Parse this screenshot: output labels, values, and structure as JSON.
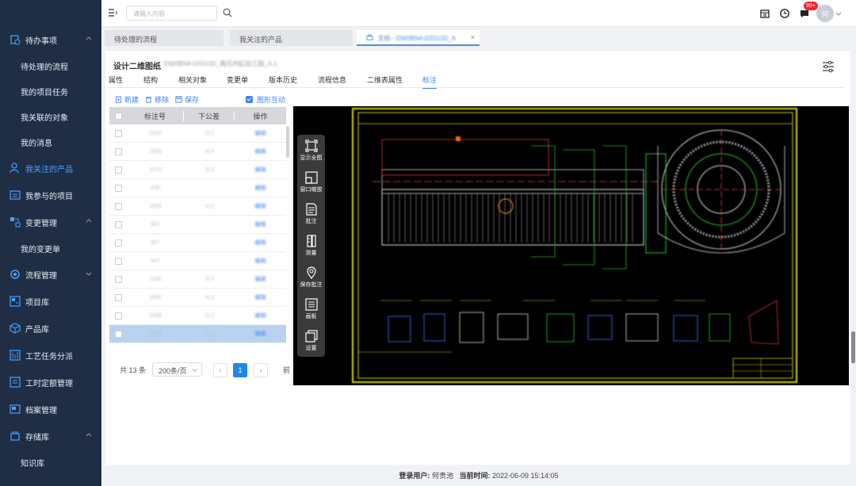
{
  "sidebar": {
    "groups": [
      {
        "label": "待办事项",
        "icon": "todo-icon",
        "expanded": true,
        "children": [
          "待处理的流程",
          "我的项目任务",
          "我关联的对象",
          "我的消息"
        ]
      },
      {
        "label": "我关注的产品",
        "icon": "user-follow-icon",
        "active": true
      },
      {
        "label": "我参与的项目",
        "icon": "project-icon"
      },
      {
        "label": "变更管理",
        "icon": "change-icon",
        "expanded": true,
        "children": [
          "我的变更单"
        ]
      },
      {
        "label": "流程管理",
        "icon": "workflow-icon",
        "expanded": false
      },
      {
        "label": "项目库",
        "icon": "library-icon"
      },
      {
        "label": "产品库",
        "icon": "cube-icon"
      },
      {
        "label": "工艺任务分派",
        "icon": "task-assign-icon"
      },
      {
        "label": "工时定额管理",
        "icon": "hours-icon"
      },
      {
        "label": "档案管理",
        "icon": "archive-icon"
      },
      {
        "label": "存储库",
        "icon": "storage-icon",
        "expanded": true,
        "children": [
          "知识库"
        ]
      }
    ]
  },
  "topbar": {
    "search_placeholder": "请输入内容",
    "notification_badge": "99+",
    "avatar_text": "何"
  },
  "tabs": [
    {
      "label": "待处理的流程",
      "active": false
    },
    {
      "label": "我关注的产品",
      "active": false
    },
    {
      "label": "文档 - DW0BN4-0201OD_A",
      "active": true,
      "close": "×"
    }
  ],
  "page": {
    "title": "设计二维图纸",
    "title_sub": "DW0BN4-0201OD_离压内缸加工图_A.1",
    "nav_tabs": [
      "属性",
      "结构",
      "相关对象",
      "变更单",
      "版本历史",
      "流程信息",
      "二维表属性",
      "标注"
    ],
    "active_nav": "标注"
  },
  "toolbar": {
    "new_label": "新建",
    "remove_label": "移除",
    "save_label": "保存",
    "interact_label": "图形互动"
  },
  "table": {
    "headers": [
      "标注号",
      "下公差",
      "操作"
    ],
    "rows": [
      {
        "no": "1610",
        "tol": "-0.2",
        "op": "编辑"
      },
      {
        "no": "1609",
        "tol": "-0.2",
        "op": "编辑"
      },
      {
        "no": "1478",
        "tol": "-0.2",
        "op": "编辑"
      },
      {
        "no": "436",
        "tol": "",
        "op": "编辑"
      },
      {
        "no": "1589",
        "tol": "-0.2",
        "op": "编辑"
      },
      {
        "no": "597",
        "tol": "",
        "op": "编辑"
      },
      {
        "no": "807",
        "tol": "",
        "op": "编辑"
      },
      {
        "no": "547",
        "tol": "",
        "op": "编辑"
      },
      {
        "no": "1430",
        "tol": "-0.2",
        "op": "编辑"
      },
      {
        "no": "1450",
        "tol": "-0.2",
        "op": "编辑"
      },
      {
        "no": "1498",
        "tol": "-0.2",
        "op": "编辑"
      },
      {
        "no": "1528",
        "tol": "-0.2",
        "op": "编辑",
        "selected": true
      }
    ]
  },
  "pagination": {
    "total": "共 13 条",
    "page_size": "200条/页",
    "current": "1",
    "goto": "前"
  },
  "viewer_tools": [
    "显示全图",
    "窗口缩放",
    "批注",
    "测量",
    "保存批注",
    "画板",
    "设置"
  ],
  "footer": {
    "user_label": "登录用户:",
    "user": "何贵池",
    "time_label": "当前时间:",
    "time": "2022-06-09 15:14:05"
  },
  "colors": {
    "sidebar_bg": "#1f2d45",
    "accent": "#3b82f6",
    "badge": "#f5222d"
  }
}
